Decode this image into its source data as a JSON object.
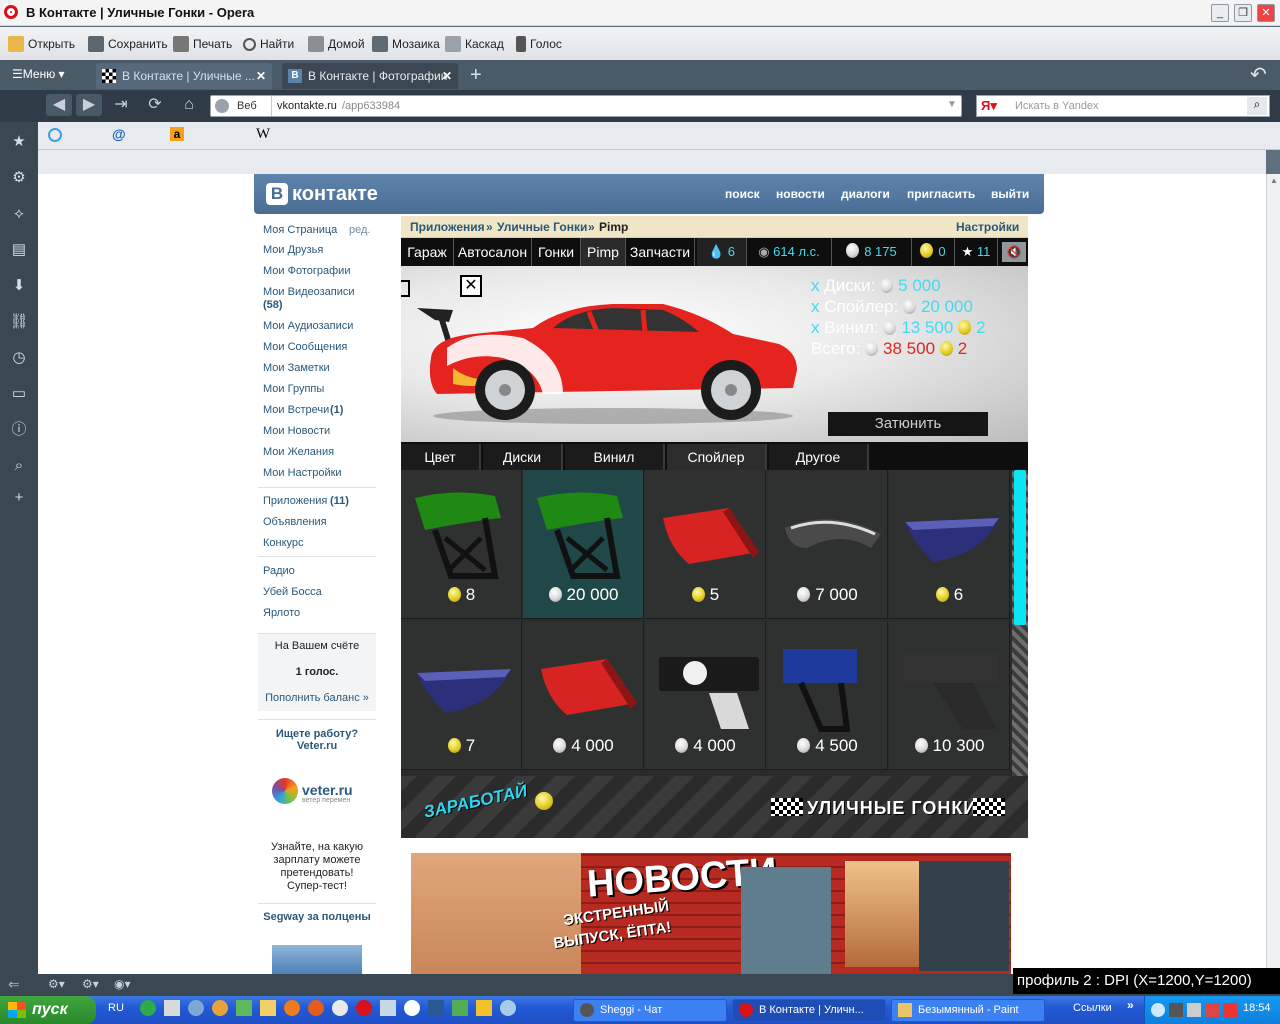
{
  "window": {
    "title": "В Контакте | Уличные Гонки - Opera"
  },
  "toolbar": {
    "open": "Открыть",
    "save": "Сохранить",
    "print": "Печать",
    "find": "Найти",
    "home": "Домой",
    "mosaic": "Мозаика",
    "cascade": "Каскад",
    "voice": "Голос"
  },
  "tabs": {
    "menu": "Меню",
    "tab1": "В Контакте | Уличные ...",
    "tab2": "В Контакте | Фотографии"
  },
  "address": {
    "mode": "Веб",
    "url_host": "vkontakte.ru",
    "url_path": "/app633984",
    "search_placeholder": "Искать в Yandex"
  },
  "vk": {
    "logo": "контакте",
    "nav": [
      "поиск",
      "новости",
      "диалоги",
      "пригласить",
      "выйти"
    ],
    "menu": {
      "my_page": "Моя Страница",
      "edit": "ред.",
      "friends": "Мои Друзья",
      "photos": "Мои Фотографии",
      "videos": "Мои Видеозаписи",
      "videos_count": "(58)",
      "audio": "Мои Аудиозаписи",
      "messages": "Мои Сообщения",
      "notes": "Мои Заметки",
      "groups": "Мои Группы",
      "events": "Мои Встречи",
      "events_count": "(1)",
      "news": "Мои Новости",
      "wishes": "Мои Желания",
      "settings": "Мои Настройки",
      "apps": "Приложения",
      "apps_count": "(11)",
      "ads": "Объявления",
      "contest": "Конкурс",
      "radio": "Радио",
      "boss": "Убей Босса",
      "yarlo": "Ярлото"
    },
    "balance": {
      "title": "На Вашем счёте",
      "value": "1 голос.",
      "link": "Пополнить баланс »"
    },
    "promo": {
      "job": "Ищете работу? Veter.ru",
      "veter_name": "veter.ru",
      "veter_sub": "ветер перемен",
      "salary": "Узнайте, на какую зарплату можете претендовать! Супер-тест!",
      "segway": "Segway за полцены"
    }
  },
  "game": {
    "breadcrumb": {
      "apps": "Приложения",
      "sep1": "»",
      "game": "Уличные Гонки",
      "sep2": "»",
      "page": "Pimp",
      "settings": "Настройки"
    },
    "tabs": [
      "Гараж",
      "Автосалон",
      "Гонки",
      "Pimp",
      "Запчасти"
    ],
    "stats": {
      "fuel": "6",
      "hp": "614 л.с.",
      "money": "8 175",
      "gold": "0",
      "stars": "11"
    },
    "summary": {
      "x": "x",
      "disks_label": "Диски:",
      "disks_value": "5 000",
      "spoiler_label": "Спойлер:",
      "spoiler_value": "20 000",
      "vinyl_label": "Винил:",
      "vinyl_value": "13 500",
      "vinyl_gold": "2",
      "total_label": "Всего:",
      "total_value": "38 500",
      "total_gold": "2"
    },
    "tune_button": "Затюнить",
    "subtabs": [
      "Цвет",
      "Диски",
      "Винил",
      "Спойлер",
      "Другое"
    ],
    "items": [
      {
        "price": "8",
        "currency": "gold",
        "shape": "green-wing"
      },
      {
        "price": "20 000",
        "currency": "silver",
        "shape": "green-wing"
      },
      {
        "price": "5",
        "currency": "gold",
        "shape": "red-lip"
      },
      {
        "price": "7 000",
        "currency": "silver",
        "shape": "carbon-lip"
      },
      {
        "price": "6",
        "currency": "gold",
        "shape": "blue-lip"
      },
      {
        "price": "7",
        "currency": "gold",
        "shape": "blue-lip"
      },
      {
        "price": "4 000",
        "currency": "silver",
        "shape": "red-lip"
      },
      {
        "price": "4 000",
        "currency": "silver",
        "shape": "shell-wing"
      },
      {
        "price": "4 500",
        "currency": "silver",
        "shape": "blue-wing"
      },
      {
        "price": "10 300",
        "currency": "silver",
        "shape": "carbon-wing"
      }
    ],
    "banner": {
      "earn": "ЗАРАБОТАЙ",
      "brand": "УЛИЧНЫЕ ГОНКИ"
    },
    "ad": {
      "title": "НОВОСТИ",
      "sub1": "ЭКСТРЕННЫЙ",
      "sub2": "ВЫПУСК, ЁПТА!"
    }
  },
  "taskbar": {
    "start": "пуск",
    "lang": "RU",
    "apps": [
      "Sheggi - Чат",
      "В Контакте | Уличн...",
      "Безымянный - Paint"
    ],
    "links": "Ссылки",
    "links_more": "»",
    "time": "18:54"
  },
  "overlay": {
    "dpi": "профиль 2 : DPI (X=1200,Y=1200)"
  },
  "colors": {
    "vk_blue": "#4a6d94",
    "game_cyan": "#44d9f2",
    "accent_red": "#e5231f"
  }
}
